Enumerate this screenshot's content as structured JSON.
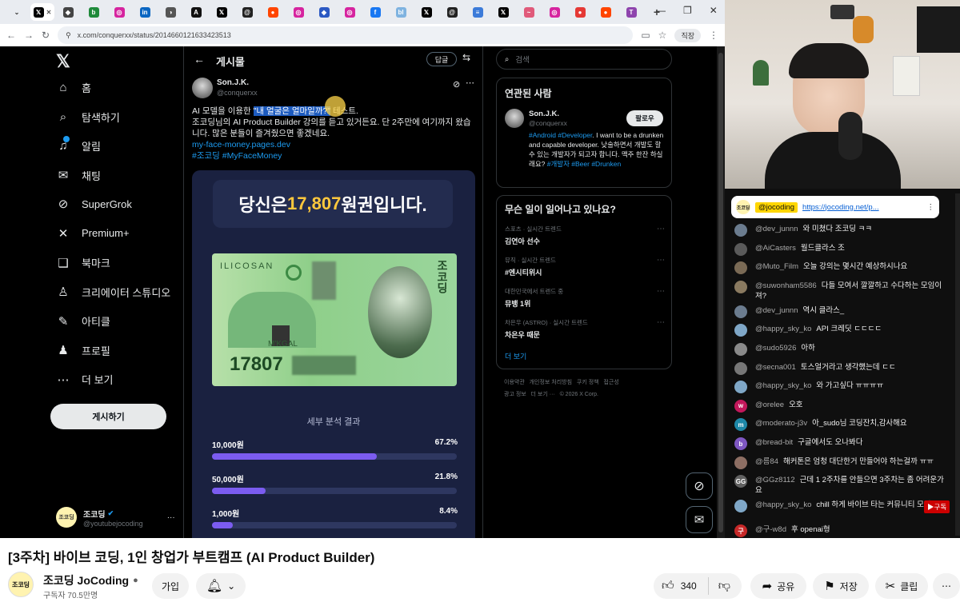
{
  "browser": {
    "tabs": [
      {
        "icon": "chevron-down-icon",
        "color": "#e9ecf1",
        "glyph": "⌄"
      },
      {
        "icon": "x-tab-icon",
        "color": "#000000",
        "glyph": "𝕏",
        "active": true
      },
      {
        "icon": "app-icon",
        "color": "#444444",
        "glyph": "◆"
      },
      {
        "icon": "tab-icon",
        "color": "#1f8a3b",
        "glyph": "b"
      },
      {
        "icon": "instagram-icon",
        "color": "#d6249f",
        "glyph": "◎"
      },
      {
        "icon": "linkedin-icon",
        "color": "#0a66c2",
        "glyph": "in"
      },
      {
        "icon": "tab-icon",
        "color": "#555555",
        "glyph": "◑"
      },
      {
        "icon": "tab-icon",
        "color": "#111111",
        "glyph": "A"
      },
      {
        "icon": "x-icon",
        "color": "#000000",
        "glyph": "𝕏"
      },
      {
        "icon": "threads-icon",
        "color": "#222222",
        "glyph": "@"
      },
      {
        "icon": "reddit-icon",
        "color": "#ff4500",
        "glyph": "●"
      },
      {
        "icon": "instagram-icon",
        "color": "#d6249f",
        "glyph": "◎"
      },
      {
        "icon": "tab-icon",
        "color": "#2b59c3",
        "glyph": "◆"
      },
      {
        "icon": "instagram-icon",
        "color": "#d6249f",
        "glyph": "◎"
      },
      {
        "icon": "facebook-icon",
        "color": "#1877f2",
        "glyph": "f"
      },
      {
        "icon": "tab-icon",
        "color": "#7fb3e0",
        "glyph": "bl"
      },
      {
        "icon": "x-icon",
        "color": "#000000",
        "glyph": "𝕏"
      },
      {
        "icon": "threads-icon",
        "color": "#222222",
        "glyph": "@"
      },
      {
        "icon": "tab-icon",
        "color": "#3c7bd9",
        "glyph": "≡"
      },
      {
        "icon": "x-icon",
        "color": "#000000",
        "glyph": "𝕏"
      },
      {
        "icon": "tab-icon",
        "color": "#e05a7a",
        "glyph": "~"
      },
      {
        "icon": "instagram-icon",
        "color": "#d6249f",
        "glyph": "◎"
      },
      {
        "icon": "tab-icon",
        "color": "#e53935",
        "glyph": "●"
      },
      {
        "icon": "reddit-icon",
        "color": "#ff4500",
        "glyph": "●"
      },
      {
        "icon": "tab-icon",
        "color": "#8e44ad",
        "glyph": "T"
      }
    ],
    "new_tab": "+",
    "url": "x.com/conquerxx/status/2014660121633423513",
    "profile_label": "직장"
  },
  "x_nav": {
    "logo": "𝕏",
    "items": [
      {
        "label": "홈",
        "icon": "home-icon",
        "glyph": "⌂"
      },
      {
        "label": "탐색하기",
        "icon": "search-icon",
        "glyph": "⌕"
      },
      {
        "label": "알림",
        "icon": "bell-icon",
        "glyph": "♫"
      },
      {
        "label": "채팅",
        "icon": "mail-icon",
        "glyph": "✉"
      },
      {
        "label": "SuperGrok",
        "icon": "grok-icon",
        "glyph": "⊘"
      },
      {
        "label": "Premium+",
        "icon": "x-icon",
        "glyph": "✕"
      },
      {
        "label": "북마크",
        "icon": "bookmark-icon",
        "glyph": "❑"
      },
      {
        "label": "크리에이터 스튜디오",
        "icon": "studio-icon",
        "glyph": "♙"
      },
      {
        "label": "아티클",
        "icon": "article-icon",
        "glyph": "✎"
      },
      {
        "label": "프로필",
        "icon": "profile-icon",
        "glyph": "♟"
      },
      {
        "label": "더 보기",
        "icon": "more-icon",
        "glyph": "⋯"
      }
    ],
    "post_button": "게시하기",
    "account_name": "조코딩",
    "account_handle": "@youtubejocoding",
    "account_more": "···"
  },
  "post": {
    "back": "←",
    "header_title": "게시물",
    "reply_label": "답글",
    "author_name": "Son.J.K.",
    "author_handle": "@conquerxx",
    "text_line1_a": "AI 모델을 이용한 ",
    "text_line1_highlight": "\"내 얼굴은 얼마일까?\"",
    "text_line1_b": " 테스트.",
    "text_line2": "조코딩님의 AI Product Builder 강의를 듣고 있거든요. 단 2주만에 여기까지 왔습니다. 많은 분들이 즐겨줬으면 좋겠네요.",
    "link": "my-face-money.pages.dev",
    "hashtags": "#조코딩 #MyFaceMoney",
    "image": {
      "headline_a": "당신은 ",
      "headline_num": "17,807",
      "headline_b": " 원권입니다.",
      "bill_amount": "17807",
      "bill_top": "ILICOSAN",
      "bill_vertical": "조코딩",
      "bill_mid": "M'KGAL",
      "analysis_title": "세부 분석 결과",
      "bars": [
        {
          "label": "10,000원",
          "pct_label": "67.2%",
          "pct": 67.2
        },
        {
          "label": "50,000원",
          "pct_label": "21.8%",
          "pct": 21.8
        },
        {
          "label": "1,000원",
          "pct_label": "8.4%",
          "pct": 8.4
        }
      ]
    }
  },
  "right": {
    "search_placeholder": "검색",
    "people_title": "연관된 사람",
    "person_name": "Son.J.K.",
    "person_handle": "@conquerxx",
    "follow": "팔로우",
    "bio_a": "#Android #Developer",
    "bio_b": ". I want to be a drunken and capable developer. 낮술하면서 개발도 할 수 있는 개발자가 되고자 합니다. 맥주 한잔 하실래요? ",
    "bio_c": "#개발자 #Beer #Drunken",
    "trends_title": "무슨 일이 일어나고 있나요?",
    "trends": [
      {
        "meta": "스포츠 · 실시간 트렌드",
        "title": "김연아 선수"
      },
      {
        "meta": "뮤직 · 실시간 트렌드",
        "title": "#엔시티위시"
      },
      {
        "meta": "대한민국에서 트렌드 중",
        "title": "뮤뱅 1위"
      },
      {
        "meta": "차은우 (ASTRO) · 실시간 트렌드",
        "title": "차은우 때문"
      }
    ],
    "show_more": "더 보기",
    "footer1": "이용약관   개인정보 처리방침   쿠키 정책   접근성",
    "footer2": "광고 정보   더 보기 ···   © 2026 X Corp."
  },
  "chat": {
    "pinned_name": "@jocoding",
    "pinned_link": "https://jocoding.net/p...",
    "messages": [
      {
        "user": "@dev_junnn",
        "text": "와 미쳤다 조코딩 ㅋㅋ",
        "color": "#6b7c8f"
      },
      {
        "user": "@AiCasters",
        "text": "월드클라스 조",
        "color": "#5a5a5a"
      },
      {
        "user": "@Muto_Film",
        "text": "오늘 강의는 몇시간 예상하시나요",
        "color": "#7a6a55"
      },
      {
        "user": "@suwonham5586",
        "text": "다들 모여서 깔깔하고 수다하는 모임이져?",
        "color": "#8a7a60"
      },
      {
        "user": "@dev_junnn",
        "text": "역시 클라스_",
        "color": "#6b7c8f"
      },
      {
        "user": "@happy_sky_ko",
        "text": "API 크레딧 ㄷㄷㄷㄷ",
        "color": "#7fa7c7"
      },
      {
        "user": "@sudo5926",
        "text": "아하",
        "color": "#8a8a8a"
      },
      {
        "user": "@secna001",
        "text": "토스얼거라고 생각했는데 ㄷㄷ",
        "color": "#777777"
      },
      {
        "user": "@happy_sky_ko",
        "text": "와 가고싶다 ㅠㅠㅠㅠ",
        "color": "#7fa7c7"
      },
      {
        "user": "@orelee",
        "text": "오호",
        "color": "#c2185b",
        "initial": "w"
      },
      {
        "user": "@moderato-j3v",
        "text": "아_sudo님 코딩잔치,감사해요",
        "color": "#1e88a8",
        "initial": "m"
      },
      {
        "user": "@bread-bit",
        "text": "구글에서도 오나봐다",
        "color": "#7e57c2",
        "initial": "b"
      },
      {
        "user": "@름84",
        "text": "해커톤은 엄청 대단한거 만들어야 하는걸까 ㅠㅠ",
        "color": "#8d6e63"
      },
      {
        "user": "@GGz8112",
        "text": "근데 1 2주차를 안들으면 3주차는 좀 어려운가요",
        "color": "#616161",
        "initial": "GG"
      },
      {
        "user": "@happy_sky_ko",
        "text": "chill 하게 바이브 타는 커뮤니티 모임",
        "color": "#7fa7c7"
      },
      {
        "user": "@구-w8d",
        "text": "후 openai형",
        "color": "#c62828",
        "initial": "구"
      }
    ],
    "subscribe_badge": "▶구독"
  },
  "video": {
    "title": "[3주차] 바이브 코딩, 1인 창업가 부트캠프 (AI Product Builder)",
    "channel": "조코딩 JoCoding",
    "subscribers": "구독자 70.5만명",
    "join": "가입",
    "likes": "340",
    "share": "공유",
    "save": "저장",
    "clip": "클립"
  },
  "colors": {
    "accent": "#1d9bf0",
    "highlight": "#ffd54a",
    "bill_green": "#8fcf8a"
  }
}
